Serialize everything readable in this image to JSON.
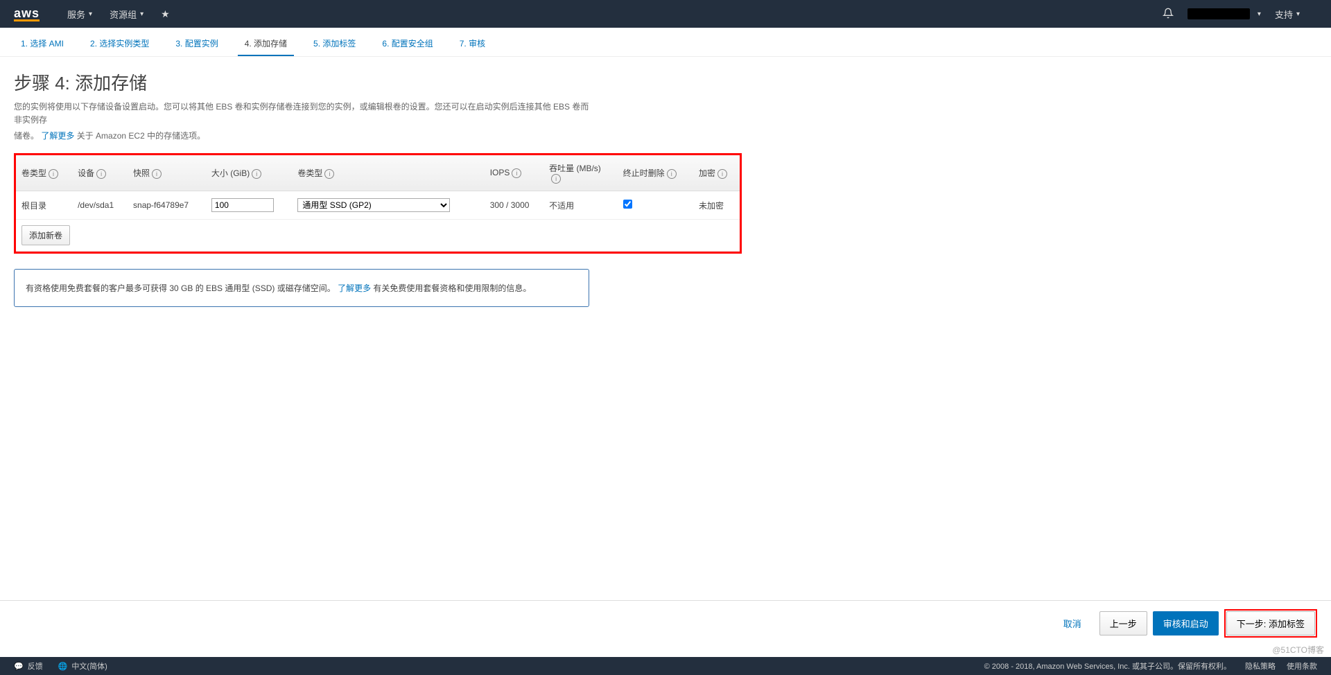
{
  "nav": {
    "logo": "aws",
    "services": "服务",
    "resource_groups": "资源组",
    "support": "支持"
  },
  "wizard": {
    "steps": [
      {
        "label": "1. 选择 AMI"
      },
      {
        "label": "2. 选择实例类型"
      },
      {
        "label": "3. 配置实例"
      },
      {
        "label": "4. 添加存储"
      },
      {
        "label": "5. 添加标签"
      },
      {
        "label": "6. 配置安全组"
      },
      {
        "label": "7. 审核"
      }
    ],
    "active_index": 3
  },
  "page": {
    "title": "步骤 4: 添加存储",
    "desc1": "您的实例将使用以下存储设备设置启动。您可以将其他 EBS 卷和实例存储卷连接到您的实例，或编辑根卷的设置。您还可以在启动实例后连接其他 EBS 卷而非实例存",
    "desc2_prefix": "储卷。",
    "learn_more": "了解更多",
    "desc2_suffix": " 关于 Amazon EC2 中的存储选项。"
  },
  "table": {
    "headers": {
      "vol_type": "卷类型",
      "device": "设备",
      "snapshot": "快照",
      "size": "大小 (GiB)",
      "vol_kind": "卷类型",
      "iops": "IOPS",
      "throughput": "吞吐量 (MB/s)",
      "delete": "终止时删除",
      "encrypt": "加密"
    },
    "row": {
      "vol_type": "根目录",
      "device": "/dev/sda1",
      "snapshot": "snap-f64789e7",
      "size_value": "100",
      "vol_kind_selected": "通用型 SSD (GP2)",
      "iops": "300 / 3000",
      "throughput": "不适用",
      "delete_checked": true,
      "encrypt": "未加密"
    },
    "add_button": "添加新卷"
  },
  "info_panel": {
    "text_before": "有资格使用免费套餐的客户最多可获得 30 GB 的 EBS 通用型 (SSD) 或磁存储空间。",
    "learn_more": "了解更多",
    "text_after": " 有关免费使用套餐资格和使用限制的信息。"
  },
  "footer": {
    "cancel": "取消",
    "prev": "上一步",
    "review": "审核和启动",
    "next": "下一步: 添加标签"
  },
  "bottom": {
    "feedback": "反馈",
    "lang": "中文(简体)",
    "copy": "© 2008 - 2018, Amazon Web Services, Inc. 或其子公司。保留所有权利。",
    "privacy": "隐私策略",
    "terms": "使用条款"
  },
  "watermark": "@51CTO博客"
}
